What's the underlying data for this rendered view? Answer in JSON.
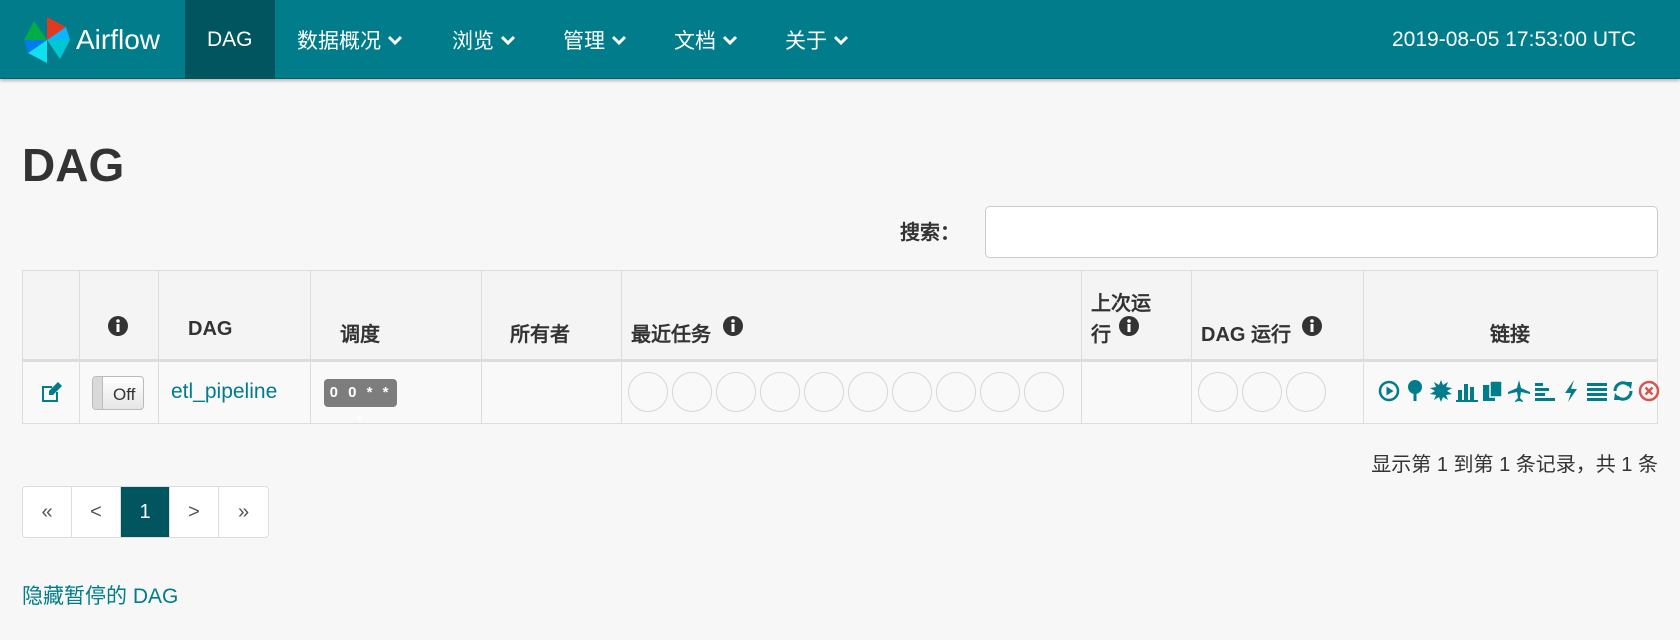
{
  "nav": {
    "brand": "Airflow",
    "items": [
      "DAG",
      "数据概况",
      "浏览",
      "管理",
      "文档",
      "关于"
    ],
    "time": "2019-08-05 17:53:00 UTC"
  },
  "page": {
    "title": "DAG",
    "search_label": "搜索：",
    "search_value": ""
  },
  "table": {
    "headers": {
      "dag": "DAG",
      "schedule": "调度",
      "owner": "所有者",
      "recent": "最近任务",
      "last_run_1": "上次运",
      "last_run_2": "行",
      "dag_runs": "DAG 运行",
      "links": "链接"
    },
    "row": {
      "toggle": "Off",
      "dag_id": "etl_pipeline",
      "schedule": "0 0 * * *",
      "owner": "",
      "last_run": ""
    }
  },
  "records_text": "显示第 1 到第 1 条记录，共 1 条",
  "pagination": [
    "«",
    "<",
    "1",
    ">",
    "»"
  ],
  "hide_paused": "隐藏暂停的 DAG",
  "colors": {
    "navbar": "#017c8a",
    "navbar_active": "#01555e",
    "link": "#017c8a",
    "delete": "#d9534f"
  }
}
